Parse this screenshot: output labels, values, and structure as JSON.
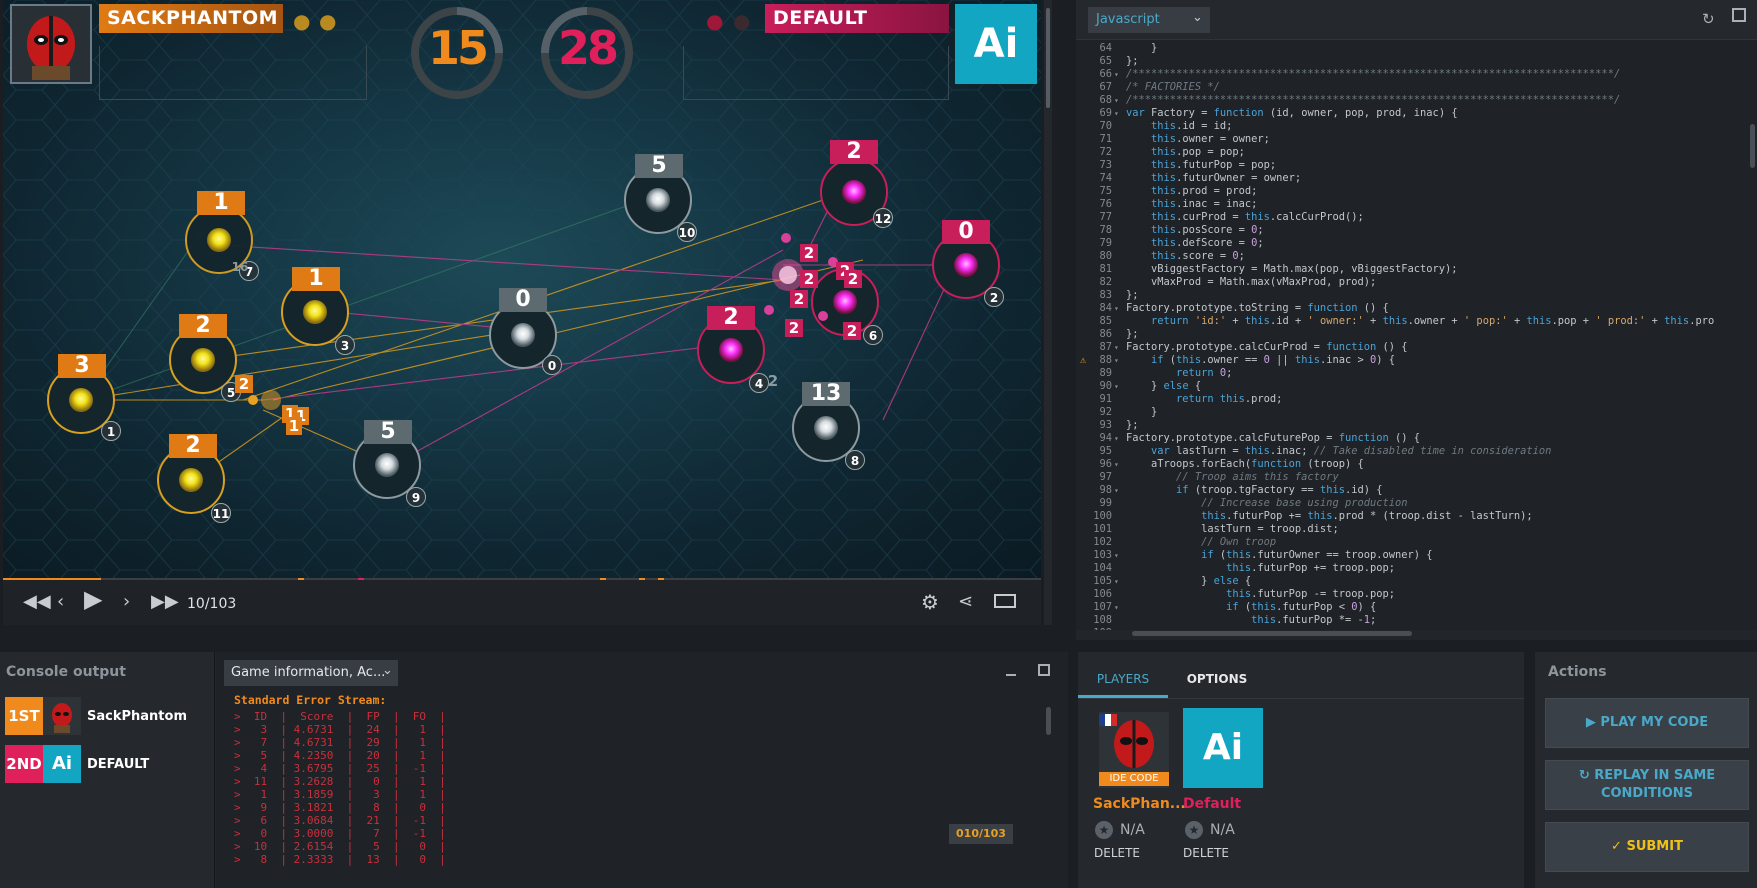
{
  "game": {
    "player1": {
      "name": "SACKPHANTOM",
      "score": "15",
      "color": "#f08a1c"
    },
    "player2": {
      "name": "DEFAULT",
      "score": "28",
      "color": "#e0205a"
    },
    "ai_logo": "Ai",
    "frame_counter": "10/103",
    "factories": [
      {
        "label": "1",
        "owner": "yellow",
        "prod": "7"
      },
      {
        "label": "1",
        "owner": "yellow",
        "prod": "3"
      },
      {
        "label": "2",
        "owner": "yellow",
        "prod": "5"
      },
      {
        "label": "3",
        "owner": "yellow",
        "prod": "1"
      },
      {
        "label": "2",
        "owner": "yellow",
        "prod": "11"
      },
      {
        "label": "5",
        "owner": "neutral",
        "prod": "10"
      },
      {
        "label": "0",
        "owner": "neutral",
        "prod": "0"
      },
      {
        "label": "5",
        "owner": "neutral",
        "prod": "9"
      },
      {
        "label": "13",
        "owner": "neutral",
        "prod": "8"
      },
      {
        "label": "2",
        "owner": "pink",
        "prod": "12"
      },
      {
        "label": "0",
        "owner": "pink",
        "prod": "2"
      },
      {
        "label": "2",
        "owner": "pink",
        "prod": "4"
      },
      {
        "label": "2",
        "owner": "pink",
        "prod": "6"
      }
    ],
    "troop_labels": [
      "2",
      "2",
      "2",
      "2",
      "2",
      "2",
      "2",
      "2",
      "1",
      "1",
      "1",
      "16",
      "2"
    ]
  },
  "code": {
    "language": "Javascript",
    "lines": [
      {
        "n": "64",
        "f": "",
        "t": "    }"
      },
      {
        "n": "65",
        "f": "",
        "t": "};"
      },
      {
        "n": "66",
        "f": "▾",
        "t": "/*****************************************************************************/",
        "cls": "cm"
      },
      {
        "n": "67",
        "f": "",
        "t": "/* FACTORIES */",
        "cls": "cm"
      },
      {
        "n": "68",
        "f": "▾",
        "t": "/*****************************************************************************/",
        "cls": "cm"
      },
      {
        "n": "69",
        "f": "▾",
        "t": "var Factory = function (id, owner, pop, prod, inac) {"
      },
      {
        "n": "70",
        "f": "",
        "t": "    this.id = id;"
      },
      {
        "n": "71",
        "f": "",
        "t": "    this.owner = owner;"
      },
      {
        "n": "72",
        "f": "",
        "t": "    this.pop = pop;"
      },
      {
        "n": "73",
        "f": "",
        "t": "    this.futurPop = pop;"
      },
      {
        "n": "74",
        "f": "",
        "t": "    this.futurOwner = owner;"
      },
      {
        "n": "75",
        "f": "",
        "t": "    this.prod = prod;"
      },
      {
        "n": "76",
        "f": "",
        "t": "    this.inac = inac;"
      },
      {
        "n": "77",
        "f": "",
        "t": "    this.curProd = this.calcCurProd();"
      },
      {
        "n": "78",
        "f": "",
        "t": "    this.posScore = 0;"
      },
      {
        "n": "79",
        "f": "",
        "t": "    this.defScore = 0;"
      },
      {
        "n": "80",
        "f": "",
        "t": "    this.score = 0;"
      },
      {
        "n": "81",
        "f": "",
        "t": "    vBiggestFactory = Math.max(pop, vBiggestFactory);"
      },
      {
        "n": "82",
        "f": "",
        "t": "    vMaxProd = Math.max(vMaxProd, prod);"
      },
      {
        "n": "83",
        "f": "",
        "t": "};"
      },
      {
        "n": "84",
        "f": "▾",
        "t": "Factory.prototype.toString = function () {"
      },
      {
        "n": "85",
        "f": "",
        "t": "    return 'id:' + this.id + ' owner:' + this.owner + ' pop:' + this.pop + ' prod:' + this.pro"
      },
      {
        "n": "86",
        "f": "",
        "t": "};"
      },
      {
        "n": "87",
        "f": "▾",
        "t": "Factory.prototype.calcCurProd = function () {"
      },
      {
        "n": "88",
        "f": "▾",
        "t": "    if (this.owner == 0 || this.inac > 0) {",
        "warn": true
      },
      {
        "n": "89",
        "f": "",
        "t": "        return 0;"
      },
      {
        "n": "90",
        "f": "▾",
        "t": "    } else {"
      },
      {
        "n": "91",
        "f": "",
        "t": "        return this.prod;"
      },
      {
        "n": "92",
        "f": "",
        "t": "    }"
      },
      {
        "n": "93",
        "f": "",
        "t": "};"
      },
      {
        "n": "94",
        "f": "▾",
        "t": "Factory.prototype.calcFuturePop = function () {"
      },
      {
        "n": "95",
        "f": "",
        "t": "    var lastTurn = this.inac; // Take disabled time in consideration"
      },
      {
        "n": "96",
        "f": "▾",
        "t": "    aTroops.forEach(function (troop) {"
      },
      {
        "n": "97",
        "f": "",
        "t": "        // Troop aims this factory",
        "cls": "cm"
      },
      {
        "n": "98",
        "f": "▾",
        "t": "        if (troop.tgFactory == this.id) {"
      },
      {
        "n": "99",
        "f": "",
        "t": "            // Increase base using production",
        "cls": "cm"
      },
      {
        "n": "100",
        "f": "",
        "t": "            this.futurPop += this.prod * (troop.dist - lastTurn);"
      },
      {
        "n": "101",
        "f": "",
        "t": "            lastTurn = troop.dist;"
      },
      {
        "n": "102",
        "f": "",
        "t": "            // Own troop",
        "cls": "cm"
      },
      {
        "n": "103",
        "f": "▾",
        "t": "            if (this.futurOwner == troop.owner) {"
      },
      {
        "n": "104",
        "f": "",
        "t": "                this.futurPop += troop.pop;"
      },
      {
        "n": "105",
        "f": "▾",
        "t": "            } else {"
      },
      {
        "n": "106",
        "f": "",
        "t": "                this.futurPop -= troop.pop;"
      },
      {
        "n": "107",
        "f": "▾",
        "t": "                if (this.futurPop < 0) {"
      },
      {
        "n": "108",
        "f": "",
        "t": "                    this.futurPop *= -1;"
      },
      {
        "n": "109",
        "f": "",
        "t": ""
      }
    ]
  },
  "console": {
    "title": "Console output",
    "ranks": [
      {
        "rank": "1ST",
        "name": "SackPhantom",
        "color": "#f08a1c"
      },
      {
        "rank": "2ND",
        "name": "DEFAULT",
        "color": "#e0205a"
      }
    ],
    "filter": "Game information, Ac...",
    "stream_title": "Standard Error Stream:",
    "header": ">  ID  |  Score  |  FP  |  FO  |",
    "rows": [
      ">   3  | 4.6731  |  24  |   1  |",
      ">   7  | 4.6731  |  29  |   1  |",
      ">   5  | 4.2350  |  20  |   1  |",
      ">   4  | 3.6795  |  25  |  -1  |",
      ">  11  | 3.2628  |   0  |   1  |",
      ">   1  | 3.1859  |   3  |   1  |",
      ">   9  | 3.1821  |   8  |   0  |",
      ">   6  | 3.0684  |  21  |  -1  |",
      ">   0  | 3.0000  |   7  |  -1  |",
      ">  10  | 2.6154  |   5  |   0  |",
      ">   8  | 2.3333  |  13  |   0  |"
    ],
    "frame_tag": "010/103"
  },
  "players_panel": {
    "tabs": [
      "PLAYERS",
      "OPTIONS"
    ],
    "p1": {
      "name": "SackPhan...",
      "badge": "IDE CODE",
      "rank": "N/A",
      "delete": "DELETE"
    },
    "p2": {
      "name": "Default",
      "logo": "Ai",
      "rank": "N/A",
      "delete": "DELETE"
    }
  },
  "actions": {
    "title": "Actions",
    "play": "PLAY MY CODE",
    "replay": "REPLAY IN SAME CONDITIONS",
    "submit": "SUBMIT"
  }
}
